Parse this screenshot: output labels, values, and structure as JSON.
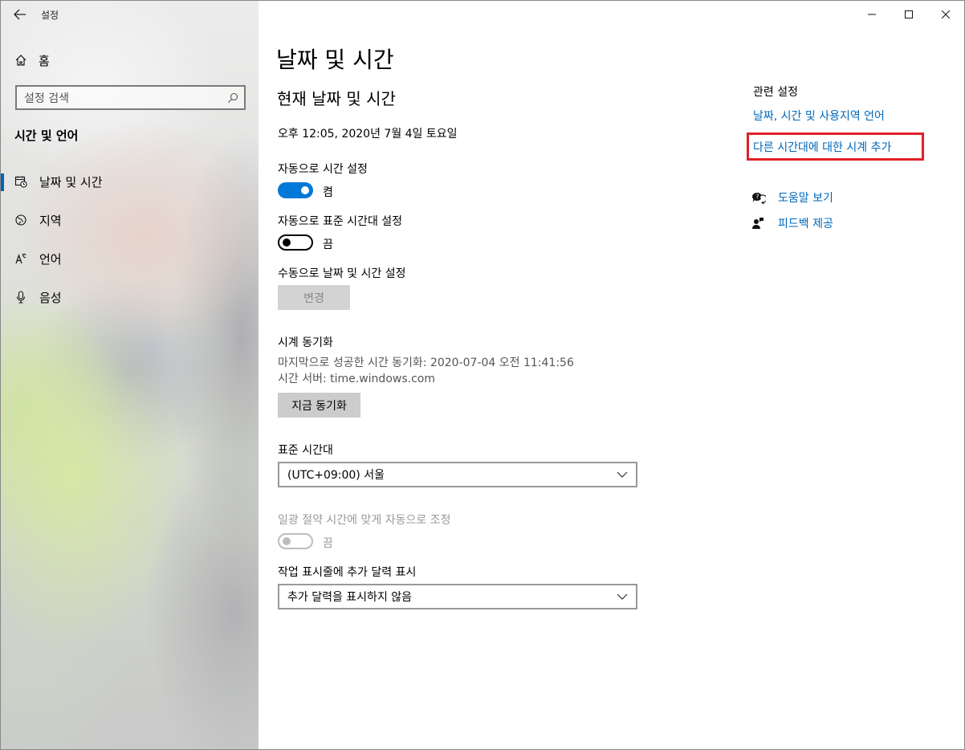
{
  "titlebar": {
    "app_title": "설정"
  },
  "sidebar": {
    "home_label": "홈",
    "search_placeholder": "설정 검색",
    "section_title": "시간 및 언어",
    "items": [
      {
        "label": "날짜 및 시간",
        "icon": "calendar-clock-icon",
        "active": true
      },
      {
        "label": "지역",
        "icon": "globe-icon",
        "active": false
      },
      {
        "label": "언어",
        "icon": "language-icon",
        "active": false
      },
      {
        "label": "음성",
        "icon": "microphone-icon",
        "active": false
      }
    ]
  },
  "main": {
    "page_title": "날짜 및 시간",
    "sub_title": "현재 날짜 및 시간",
    "current_datetime": "오후 12:05, 2020년 7월 4일 토요일",
    "auto_time": {
      "label": "자동으로 시간 설정",
      "state": "켬"
    },
    "auto_timezone": {
      "label": "자동으로 표준 시간대 설정",
      "state": "끔"
    },
    "manual": {
      "label": "수동으로 날짜 및 시간 설정",
      "button": "변경"
    },
    "sync": {
      "title": "시계 동기화",
      "last_sync": "마지막으로 성공한 시간 동기화: 2020-07-04 오전 11:41:56",
      "server": "시간 서버: time.windows.com",
      "button": "지금 동기화"
    },
    "timezone": {
      "label": "표준 시간대",
      "value": "(UTC+09:00) 서울"
    },
    "dst": {
      "label": "일광 절약 시간에 맞게 자동으로 조정",
      "state": "끔"
    },
    "calendar": {
      "label": "작업 표시줄에 추가 달력 표시",
      "value": "추가 달력을 표시하지 않음"
    }
  },
  "related": {
    "title": "관련 설정",
    "link1": "날짜, 시간 및 사용지역 언어",
    "link2": "다른 시간대에 대한 시계 추가",
    "help": "도움말 보기",
    "feedback": "피드백 제공"
  },
  "colors": {
    "accent": "#0078d7",
    "link": "#0067b8",
    "highlight": "#e0202a"
  }
}
